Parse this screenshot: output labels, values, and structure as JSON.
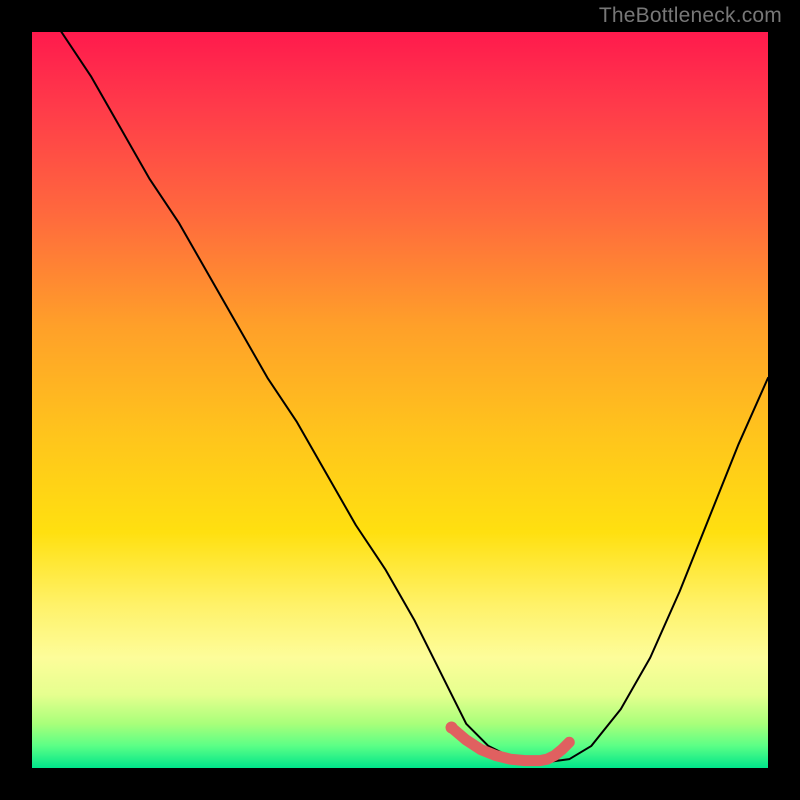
{
  "watermark": "TheBottleneck.com",
  "chart_data": {
    "type": "line",
    "title": "",
    "xlabel": "",
    "ylabel": "",
    "xlim": [
      0,
      100
    ],
    "ylim": [
      0,
      100
    ],
    "series": [
      {
        "name": "curve",
        "color": "#000000",
        "x": [
          4,
          8,
          12,
          16,
          20,
          24,
          28,
          32,
          36,
          40,
          44,
          48,
          52,
          55,
          57,
          59,
          62,
          65,
          68,
          70,
          73,
          76,
          80,
          84,
          88,
          92,
          96,
          100
        ],
        "values": [
          100,
          94,
          87,
          80,
          74,
          67,
          60,
          53,
          47,
          40,
          33,
          27,
          20,
          14,
          10,
          6,
          3,
          1.5,
          0.8,
          0.8,
          1.2,
          3,
          8,
          15,
          24,
          34,
          44,
          53
        ]
      }
    ],
    "highlight": {
      "name": "optimal-range",
      "color": "#e06060",
      "x": [
        57,
        59,
        61,
        63,
        65,
        67,
        69,
        70,
        71,
        72,
        73
      ],
      "values": [
        5.5,
        3.8,
        2.5,
        1.7,
        1.2,
        1.0,
        1.0,
        1.2,
        1.7,
        2.5,
        3.5
      ]
    },
    "highlight_start_marker": {
      "x": 57,
      "y": 5.5,
      "r": 6,
      "color": "#e06060"
    },
    "background_gradient": {
      "top_color": "#ff1a4d",
      "bottom_color": "#00e58a",
      "stops": [
        "red",
        "orange",
        "yellow",
        "green"
      ]
    }
  }
}
